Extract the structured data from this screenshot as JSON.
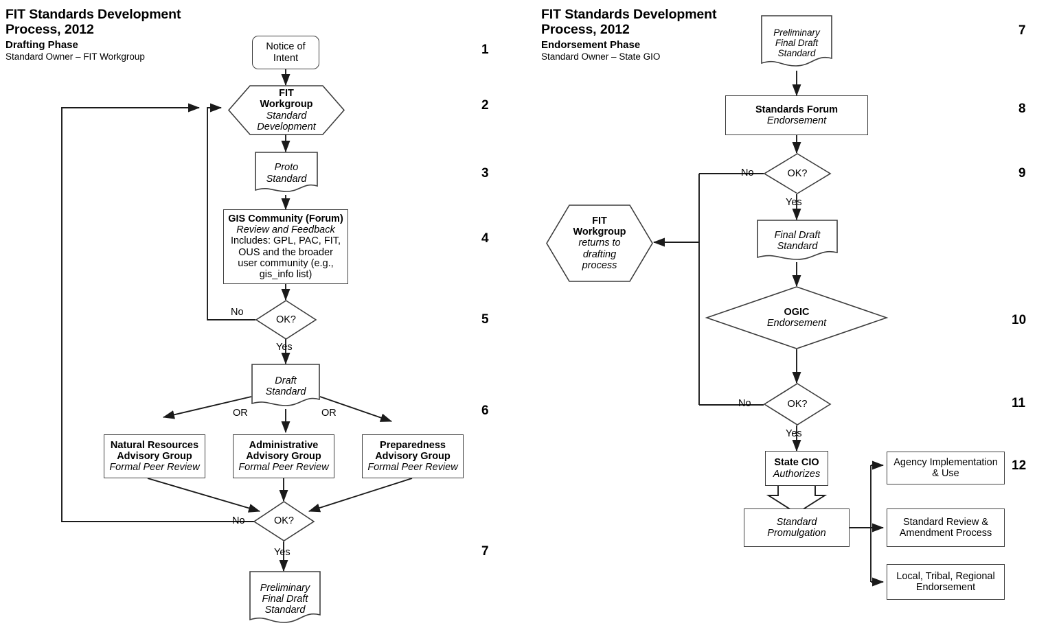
{
  "left_panel": {
    "title_line1": "FIT Standards Development",
    "title_line2": "Process, 2012",
    "phase": "Drafting Phase",
    "owner": "Standard Owner – FIT Workgroup",
    "step_numbers": [
      "1",
      "2",
      "3",
      "4",
      "5",
      "6",
      "7"
    ],
    "nodes": {
      "notice_of_intent": {
        "line1": "Notice of",
        "line2": "Intent"
      },
      "fit_workgroup": {
        "line1": "FIT",
        "line2": "Workgroup",
        "line3": "Standard",
        "line4": "Development"
      },
      "proto_standard": {
        "line1": "Proto",
        "line2": "Standard"
      },
      "gis_community": {
        "line1": "GIS Community (Forum)",
        "line2": "Review and Feedback",
        "line3": "Includes: GPL, PAC, FIT,",
        "line4": "OUS and the broader",
        "line5": "user community (e.g.,",
        "line6": "gis_info list)"
      },
      "decision_1": {
        "label": "OK?",
        "no": "No",
        "yes": "Yes"
      },
      "draft_standard": {
        "line1": "Draft",
        "line2": "Standard"
      },
      "or_left": "OR",
      "or_right": "OR",
      "natural_resources": {
        "line1": "Natural Resources",
        "line2": "Advisory Group",
        "line3": "Formal Peer Review"
      },
      "administrative": {
        "line1": "Administrative",
        "line2": "Advisory Group",
        "line3": "Formal Peer Review"
      },
      "preparedness": {
        "line1": "Preparedness",
        "line2": "Advisory Group",
        "line3": "Formal Peer Review"
      },
      "decision_2": {
        "label": "OK?",
        "no": "No",
        "yes": "Yes"
      },
      "preliminary_final_draft": {
        "line1": "Preliminary",
        "line2": "Final Draft",
        "line3": "Standard"
      }
    }
  },
  "right_panel": {
    "title_line1": "FIT Standards Development",
    "title_line2": "Process, 2012",
    "phase": "Endorsement Phase",
    "owner": "Standard Owner – State GIO",
    "step_numbers": [
      "7",
      "8",
      "9",
      "10",
      "11",
      "12"
    ],
    "nodes": {
      "preliminary_final_draft": {
        "line1": "Preliminary",
        "line2": "Final Draft",
        "line3": "Standard"
      },
      "standards_forum": {
        "line1": "Standards Forum",
        "line2": "Endorsement"
      },
      "decision_3": {
        "label": "OK?",
        "no": "No",
        "yes": "Yes"
      },
      "fit_workgroup_return": {
        "line1": "FIT",
        "line2": "Workgroup",
        "line3": "returns to",
        "line4": "drafting",
        "line5": "process"
      },
      "final_draft_standard": {
        "line1": "Final Draft",
        "line2": "Standard"
      },
      "ogic": {
        "line1": "OGIC",
        "line2": "Endorsement"
      },
      "decision_4": {
        "label": "OK?",
        "no": "No",
        "yes": "Yes"
      },
      "state_cio": {
        "line1": "State CIO",
        "line2": "Authorizes"
      },
      "standard_promulgation": {
        "line1": "Standard",
        "line2": "Promulgation"
      },
      "agency_implementation": {
        "line1": "Agency Implementation",
        "line2": "& Use"
      },
      "standard_review": {
        "line1": "Standard Review &",
        "line2": "Amendment Process"
      },
      "local_tribal": {
        "line1": "Local, Tribal, Regional",
        "line2": "Endorsement"
      }
    }
  },
  "colors": {
    "stroke": "#3d3d3d",
    "line": "#1a1a1a",
    "text": "#000000",
    "background": "#ffffff"
  }
}
